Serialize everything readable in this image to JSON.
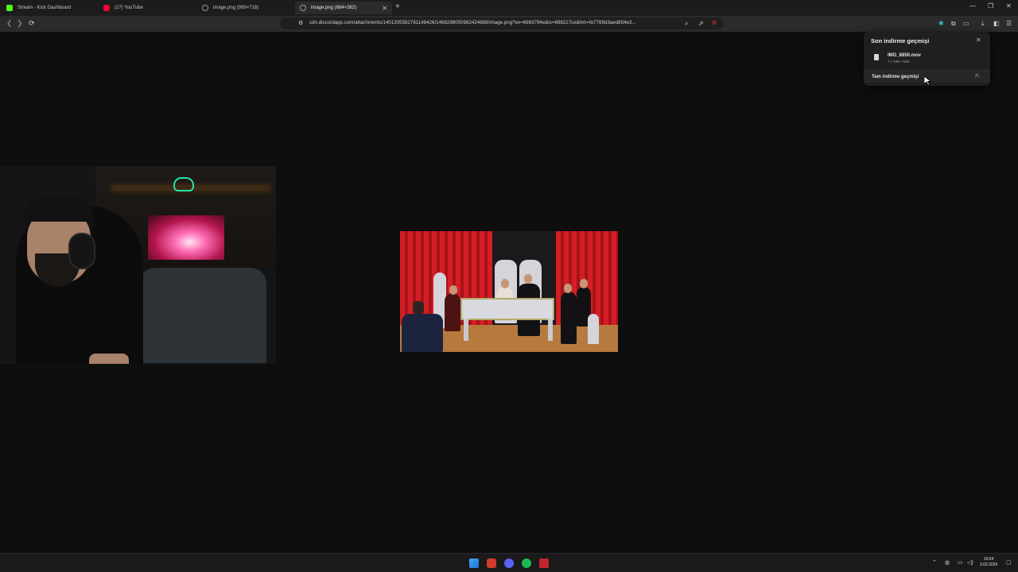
{
  "tabs": [
    {
      "label": "Stream - Kick Dashboard",
      "favicon": "kick-icon",
      "color": "#53fc18"
    },
    {
      "label": "(27) YouTube",
      "favicon": "youtube-icon",
      "color": "#ff0033"
    },
    {
      "label": "image.png (999×718)",
      "favicon": "globe-icon",
      "color": "#9a9a9a"
    },
    {
      "label": "image.png (684×382)",
      "favicon": "globe-icon",
      "color": "#9a9a9a",
      "active": true
    }
  ],
  "toolbar": {
    "url": "cdn.discordapp.com/attachments/1401305582761148426/1468288050982424688/image.png?ex=6983794e&is=698227ce&hm=fe7769d3aed854e3..."
  },
  "downloads": {
    "title": "Son indirme geçmişi",
    "items": [
      {
        "name": "IMG_8850.mov",
        "meta": "7,7 MB • Bitti"
      }
    ],
    "full_history_label": "Tam indirme geçmişi"
  },
  "clock": {
    "time": "19:54",
    "date": "3.02.2026"
  },
  "colors": {
    "accent": "#d43b2f",
    "tray_green": "#1db954"
  }
}
